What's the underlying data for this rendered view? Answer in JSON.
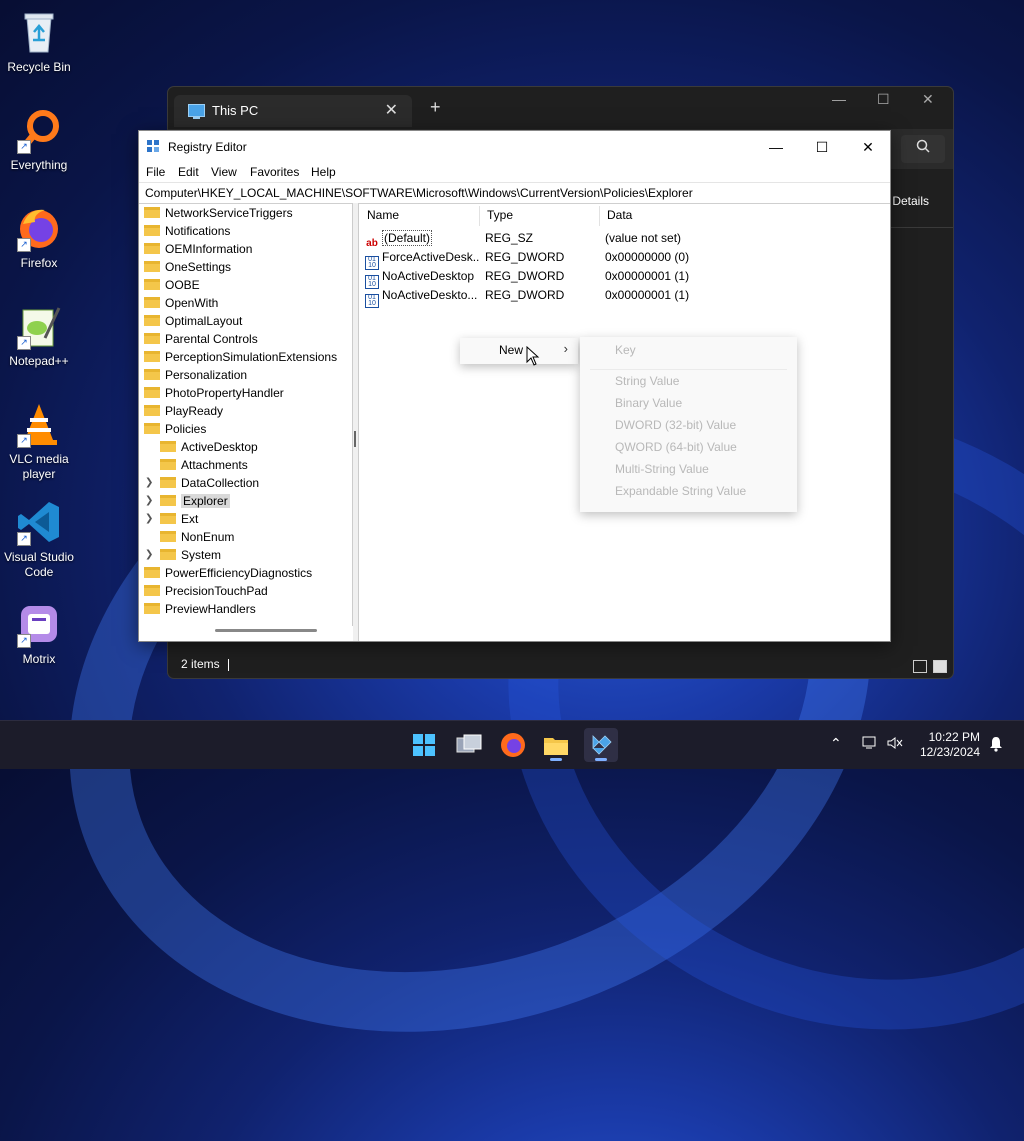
{
  "desktop": {
    "icons": [
      {
        "label": "Recycle Bin"
      },
      {
        "label": "Everything"
      },
      {
        "label": "Firefox"
      },
      {
        "label": "Notepad++"
      },
      {
        "label": "VLC media player"
      },
      {
        "label": "Visual Studio Code"
      },
      {
        "label": "Motrix"
      }
    ]
  },
  "thispc": {
    "tab_title": "This PC",
    "details_label": "Details",
    "status": "2 items"
  },
  "regedit": {
    "title": "Registry Editor",
    "menu": [
      "File",
      "Edit",
      "View",
      "Favorites",
      "Help"
    ],
    "address": "Computer\\HKEY_LOCAL_MACHINE\\SOFTWARE\\Microsoft\\Windows\\CurrentVersion\\Policies\\Explorer",
    "tree": [
      {
        "label": "NetworkServiceTriggers"
      },
      {
        "label": "Notifications"
      },
      {
        "label": "OEMInformation"
      },
      {
        "label": "OneSettings"
      },
      {
        "label": "OOBE"
      },
      {
        "label": "OpenWith"
      },
      {
        "label": "OptimalLayout"
      },
      {
        "label": "Parental Controls"
      },
      {
        "label": "PerceptionSimulationExtensions"
      },
      {
        "label": "Personalization"
      },
      {
        "label": "PhotoPropertyHandler"
      },
      {
        "label": "PlayReady"
      },
      {
        "label": "Policies"
      },
      {
        "label": "ActiveDesktop"
      },
      {
        "label": "Attachments"
      },
      {
        "label": "DataCollection"
      },
      {
        "label": "Explorer"
      },
      {
        "label": "Ext"
      },
      {
        "label": "NonEnum"
      },
      {
        "label": "System"
      },
      {
        "label": "PowerEfficiencyDiagnostics"
      },
      {
        "label": "PrecisionTouchPad"
      },
      {
        "label": "PreviewHandlers"
      }
    ],
    "columns": {
      "name": "Name",
      "type": "Type",
      "data": "Data"
    },
    "values": [
      {
        "name": "(Default)",
        "type": "REG_SZ",
        "data": "(value not set)"
      },
      {
        "name": "ForceActiveDesk...",
        "type": "REG_DWORD",
        "data": "0x00000000 (0)"
      },
      {
        "name": "NoActiveDesktop",
        "type": "REG_DWORD",
        "data": "0x00000001 (1)"
      },
      {
        "name": "NoActiveDeskto...",
        "type": "REG_DWORD",
        "data": "0x00000001 (1)"
      }
    ]
  },
  "context_menu": {
    "new_label": "New",
    "submenu": [
      "Key",
      "String Value",
      "Binary Value",
      "DWORD (32-bit) Value",
      "QWORD (64-bit) Value",
      "Multi-String Value",
      "Expandable String Value"
    ]
  },
  "taskbar": {
    "time": "10:22 PM",
    "date": "12/23/2024"
  },
  "colors": {
    "accent": "#2d74c9",
    "folder": "#f4c64a"
  }
}
